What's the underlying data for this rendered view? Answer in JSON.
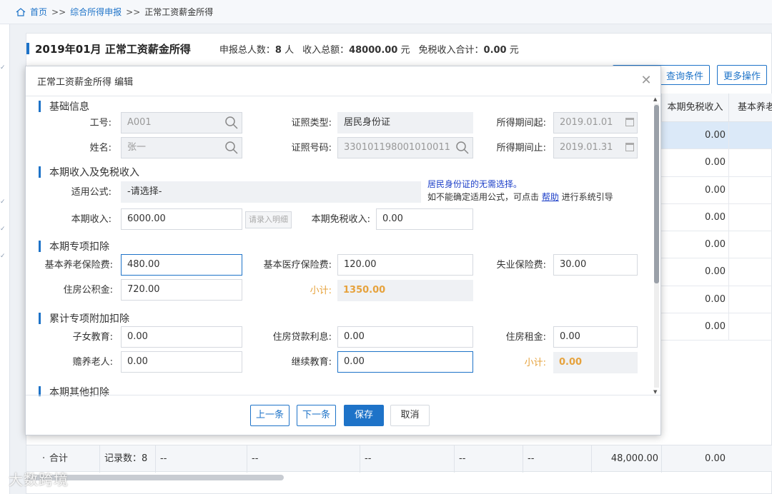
{
  "breadcrumb": {
    "home": "首页",
    "sep": ">>",
    "level2": "综合所得申报",
    "current": "正常工资薪金所得"
  },
  "header": {
    "title": "2019年01月 正常工资薪金所得",
    "people_label": "申报总人数：",
    "people_value": "8",
    "people_unit": "人",
    "income_label": "收入总额：",
    "income_value": "48000.00",
    "income_unit": "元",
    "taxfree_label": "免税收入合计：",
    "taxfree_value": "0.00",
    "taxfree_unit": "元"
  },
  "toolbar": {
    "query": "查询条件",
    "more": "更多操作"
  },
  "grid": {
    "col_taxfree": "本期免税收入",
    "col_pension": "基本养老",
    "rows": [
      "0.00",
      "0.00",
      "0.00",
      "0.00",
      "0.00",
      "0.00",
      "0.00",
      "0.00"
    ],
    "footer": {
      "label": "合计",
      "count_label": "记录数：8",
      "dash": "--",
      "income_total": "48,000.00",
      "taxfree_total": "0.00"
    }
  },
  "watermark": "大数跨境",
  "modal": {
    "title": "正常工资薪金所得 编辑",
    "sections": {
      "basic": "基础信息",
      "income": "本期收入及免税收入",
      "special": "本期专项扣除",
      "additional": "累计专项附加扣除",
      "other": "本期其他扣除"
    },
    "basic": {
      "emp_no_label": "工号:",
      "emp_no": "A001",
      "name_label": "姓名:",
      "name": "张一",
      "id_type_label": "证照类型:",
      "id_type": "居民身份证",
      "id_no_label": "证照号码:",
      "id_no": "330101198001010011",
      "period_start_label": "所得期间起:",
      "period_start": "2019.01.01",
      "period_end_label": "所得期间止:",
      "period_end": "2019.01.31"
    },
    "income": {
      "formula_label": "适用公式:",
      "formula": "-请选择-",
      "hint_line1": "居民身份证的无需选择。",
      "hint_line2_pre": "如不能确定适用公式，可点击 ",
      "hint_link": "帮助",
      "hint_line2_post": " 进行系统引导",
      "income_label": "本期收入:",
      "income": "6000.00",
      "detail_btn": "请录入明细",
      "taxfree_label": "本期免税收入:",
      "taxfree": "0.00"
    },
    "special": {
      "pension_label": "基本养老保险费:",
      "pension": "480.00",
      "medical_label": "基本医疗保险费:",
      "medical": "120.00",
      "unemp_label": "失业保险费:",
      "unemp": "30.00",
      "housing_label": "住房公积金:",
      "housing": "720.00",
      "subtotal_label": "小计:",
      "subtotal": "1350.00"
    },
    "additional": {
      "child_label": "子女教育:",
      "child": "0.00",
      "loan_label": "住房贷款利息:",
      "loan": "0.00",
      "rent_label": "住房租金:",
      "rent": "0.00",
      "elder_label": "赡养老人:",
      "elder": "0.00",
      "edu_label": "继续教育:",
      "edu": "0.00",
      "subtotal_label": "小计:",
      "subtotal": "0.00"
    },
    "buttons": {
      "prev": "上一条",
      "next": "下一条",
      "save": "保存",
      "cancel": "取消"
    }
  }
}
